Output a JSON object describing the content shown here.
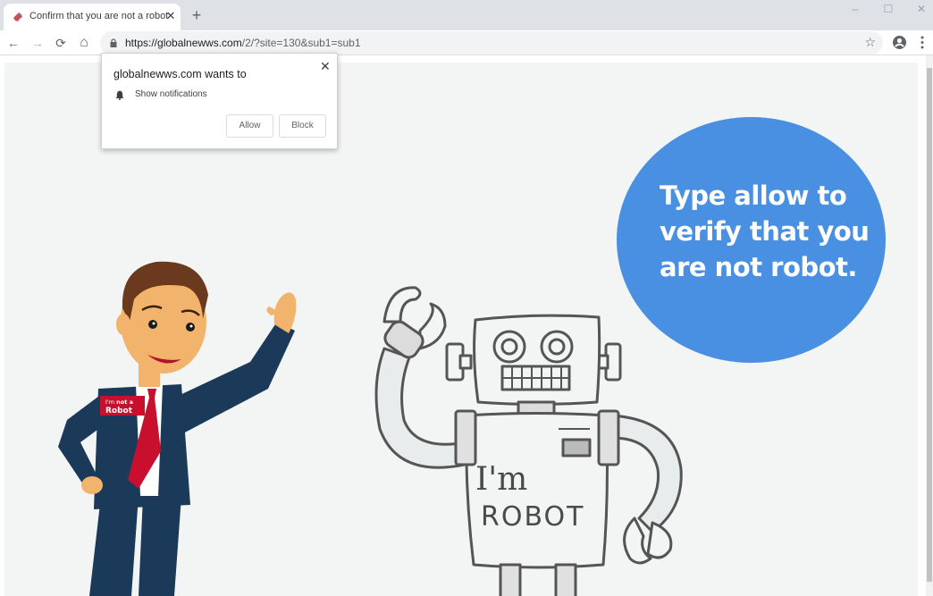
{
  "browser": {
    "tab": {
      "title": "Confirm that you are not a robot",
      "favicon": "puzzle-favicon-icon",
      "close_icon": "close-icon"
    },
    "new_tab_icon": "plus-icon",
    "window_controls": {
      "minimize": "–",
      "maximize": "☐",
      "close": "✕"
    },
    "nav": {
      "back": "←",
      "forward": "→",
      "reload": "⟳",
      "home": "⌂"
    },
    "address_bar": {
      "secure_icon": "lock-icon",
      "url_host": "https://globalnewws.com",
      "url_rest": "/2/?site=130&sub1=sub1",
      "bookmark_icon": "☆"
    },
    "profile_icon": "account-circle-icon",
    "menu_icon": "kebab-menu-icon"
  },
  "permission_popup": {
    "title": "globalnewws.com wants to",
    "close": "✕",
    "permission_icon": "bell-icon",
    "permission": "Show notifications",
    "allow_label": "Allow",
    "block_label": "Block"
  },
  "page": {
    "bubble_text": "Type allow to verify that you are not robot.",
    "bubble_color": "#4a90e2",
    "man_badge_line1_a": "I'm ",
    "man_badge_line1_b": "not a",
    "man_badge_line2": "Robot",
    "robot_text_line1": "I'm",
    "robot_text_line2": "ROBOT"
  }
}
